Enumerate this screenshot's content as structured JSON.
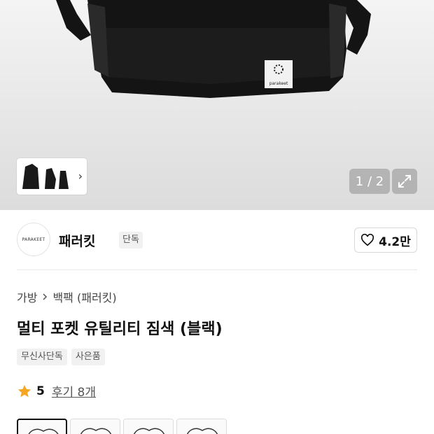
{
  "gallery": {
    "counter": "1 / 2",
    "bag_label": "parakeet",
    "thumb_chevron": "›"
  },
  "brand": {
    "logo_text": "PARAKEET",
    "name": "패러킷",
    "badge": "단독",
    "like_count": "4.2만"
  },
  "breadcrumb": {
    "items": [
      "가방",
      "백팩 (패러킷)"
    ]
  },
  "product": {
    "title": "멀티 포켓 유틸리티 짐색 (블랙)",
    "tags": [
      "무신사단독",
      "사은품"
    ],
    "rating": "5",
    "review_text": "후기 8개"
  },
  "colors": {
    "star": "#f5a623",
    "bag": "#141414"
  }
}
